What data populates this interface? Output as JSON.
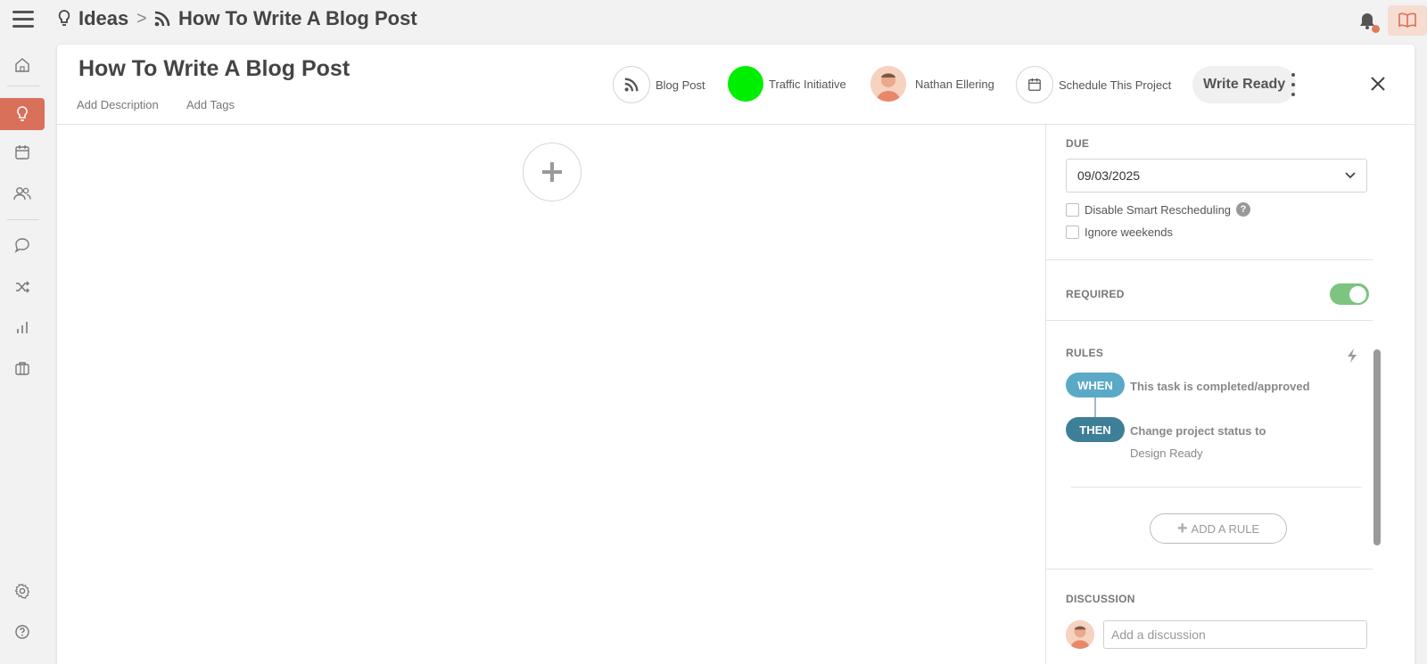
{
  "breadcrumb": {
    "section": "Ideas",
    "separator": ">",
    "current": "How To Write A Blog Post"
  },
  "project": {
    "title": "How To Write A Blog Post",
    "add_description": "Add Description",
    "add_tags": "Add Tags",
    "type_label": "Blog Post",
    "campaign_label": "Traffic Initiative",
    "campaign_color": "#00ee00",
    "owner_name": "Nathan Ellering",
    "schedule_label": "Schedule This Project",
    "status_label": "Write Ready"
  },
  "sidebar": {
    "due_label": "DUE",
    "due_value": "09/03/2025",
    "disable_smart_label": "Disable Smart Rescheduling",
    "help_glyph": "?",
    "ignore_weekends_label": "Ignore weekends",
    "required_label": "REQUIRED",
    "required_on": true,
    "rules_label": "RULES",
    "when_label": "WHEN",
    "when_text": "This task is completed/approved",
    "then_label": "THEN",
    "then_text": "Change project status to",
    "then_value": "Design Ready",
    "add_rule_label": "ADD A RULE",
    "discussion_label": "DISCUSSION",
    "discussion_placeholder": "Add a discussion"
  },
  "colors": {
    "accent": "#d9705a",
    "toggle_on": "#7cc47f",
    "when_pill": "#5aa9c6",
    "then_pill": "#3d7f97"
  },
  "icons": {
    "nav": [
      "home-icon",
      "lightbulb-icon",
      "calendar-icon",
      "people-icon",
      "chat-icon",
      "shuffle-icon",
      "bar-chart-icon",
      "briefcase-icon",
      "gear-icon",
      "help-circle-icon"
    ]
  }
}
